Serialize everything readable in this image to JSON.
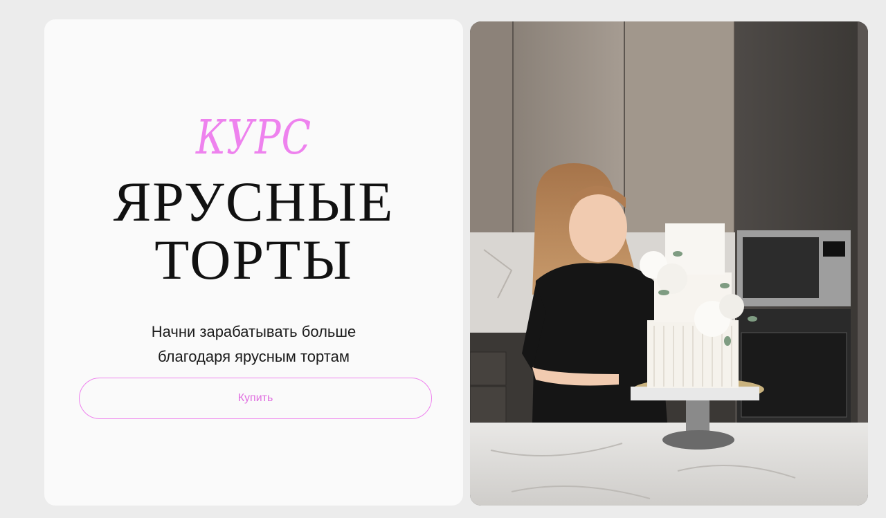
{
  "hero": {
    "eyebrow": "КУРС",
    "title_line1": "ЯРУСНЫЕ",
    "title_line2": "ТОРТЫ",
    "subtitle_line1": "Начни зарабатывать больше",
    "subtitle_line2": "благодаря ярусным тортам",
    "buy_label": "Купить"
  },
  "colors": {
    "accent": "#ee82ee",
    "page_bg": "#ececec",
    "card_bg": "#fafafa"
  },
  "photo": {
    "description_icon": "photo-woman-with-tiered-cake"
  }
}
